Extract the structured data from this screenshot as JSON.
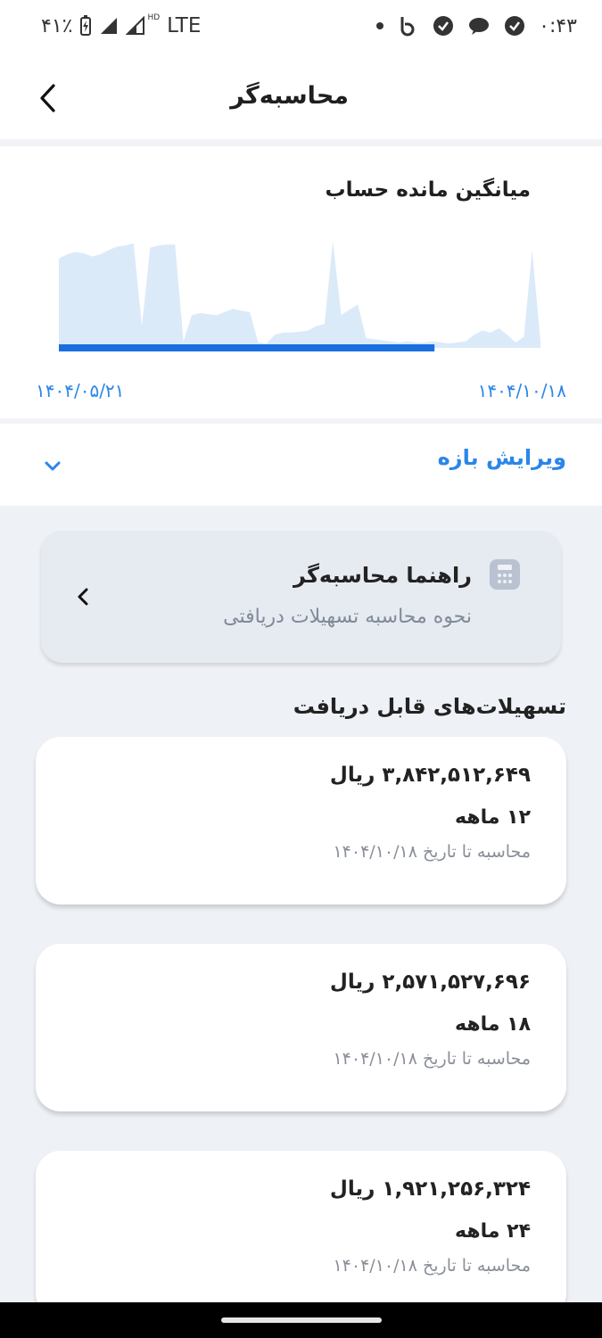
{
  "status_bar": {
    "battery": "۴۱٪",
    "network": "LTE",
    "hd": "HD",
    "time": "۰:۴۳"
  },
  "app_bar": {
    "title": "محاسبه‌گر"
  },
  "balance_chart": {
    "title": "میانگین مانده حساب",
    "start_date": "۱۴۰۴/۰۵/۲۱",
    "end_date": "۱۴۰۴/۱۰/۱۸"
  },
  "chart_data": {
    "type": "area",
    "title": "میانگین مانده حساب",
    "x_start": "۱۴۰۴/۰۵/۲۱",
    "x_end": "۱۴۰۴/۱۰/۱۸",
    "values": [
      0.82,
      0.86,
      0.88,
      0.87,
      0.84,
      0.86,
      0.9,
      0.93,
      0.94,
      0.96,
      0.2,
      0.92,
      0.94,
      0.95,
      0.95,
      0.06,
      0.3,
      0.32,
      0.31,
      0.3,
      0.33,
      0.36,
      0.34,
      0.33,
      0.05,
      0.04,
      0.12,
      0.14,
      0.14,
      0.15,
      0.16,
      0.2,
      0.22,
      0.98,
      0.3,
      0.35,
      0.4,
      0.09,
      0.08,
      0.07,
      0.06,
      0.05,
      0.06,
      0.05,
      0.05,
      0.06,
      0.05,
      0.04,
      0.05,
      0.06,
      0.12,
      0.16,
      0.14,
      0.18,
      0.12,
      0.05,
      0.1,
      0.9,
      0.06
    ],
    "fill_color": "#dbeaf9",
    "selected_range_color": "#1a6fe0",
    "selected_range_fraction": [
      0.0,
      0.78
    ]
  },
  "range": {
    "label": "ویرایش بازه",
    "icon": "chevron-down-icon"
  },
  "guide": {
    "title": "راهنما محاسبه‌گر",
    "subtitle": "نحوه محاسبه تسهیلات دریافتی",
    "icon": "calculator-icon"
  },
  "loans_section": {
    "title": "تسهیلات‌های قابل دریافت",
    "items": [
      {
        "amount": "۳,۸۴۲,۵۱۲,۶۴۹ ریال",
        "term": "۱۲ ماهه",
        "calc": "محاسبه تا تاریخ ۱۴۰۴/۱۰/۱۸"
      },
      {
        "amount": "۲,۵۷۱,۵۲۷,۶۹۶ ریال",
        "term": "۱۸ ماهه",
        "calc": "محاسبه تا تاریخ ۱۴۰۴/۱۰/۱۸"
      },
      {
        "amount": "۱,۹۲۱,۲۵۶,۳۲۴ ریال",
        "term": "۲۴ ماهه",
        "calc": "محاسبه تا تاریخ ۱۴۰۴/۱۰/۱۸"
      }
    ]
  },
  "colors": {
    "accent": "#2c86e8",
    "background": "#eef1f6"
  }
}
